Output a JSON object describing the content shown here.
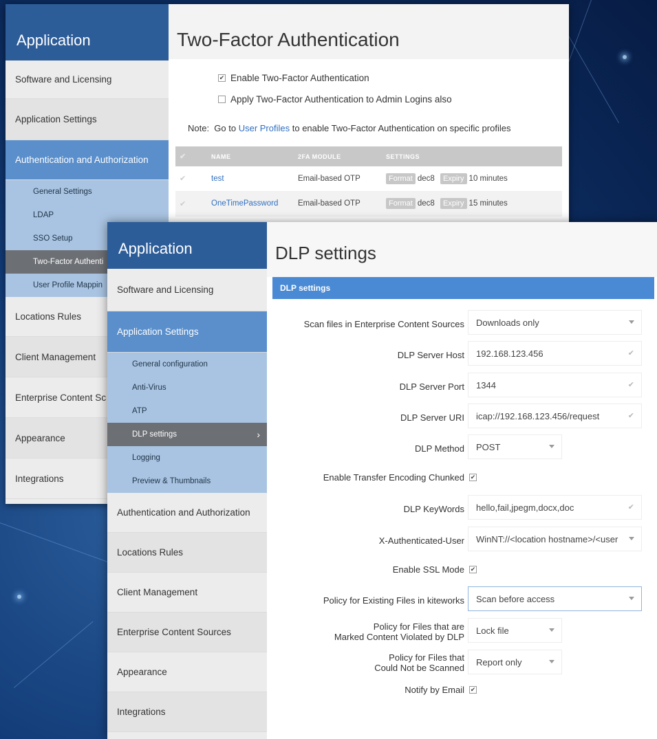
{
  "back_window": {
    "sidebar": {
      "app_title": "Application",
      "items": [
        {
          "label": "Software and Licensing"
        },
        {
          "label": "Application Settings"
        },
        {
          "label": "Authentication and Authorization"
        },
        {
          "label": "Locations Rules"
        },
        {
          "label": "Client Management"
        },
        {
          "label": "Enterprise Content Sc"
        },
        {
          "label": "Appearance"
        },
        {
          "label": "Integrations"
        }
      ],
      "sub_items": [
        {
          "label": "General Settings"
        },
        {
          "label": "LDAP"
        },
        {
          "label": "SSO Setup"
        },
        {
          "label": "Two-Factor Authenti"
        },
        {
          "label": "User Profile Mappin"
        }
      ]
    },
    "main": {
      "title": "Two-Factor Authentication",
      "enable_2fa_label": "Enable Two-Factor Authentication",
      "admin_2fa_label": "Apply Two-Factor Authentication to Admin Logins also",
      "note_prefix": "Note:  Go to ",
      "note_link": "User Profiles",
      "note_suffix": " to enable Two-Factor Authentication on specific profiles",
      "table": {
        "headers": [
          "NAME",
          "2FA MODULE",
          "SETTINGS"
        ],
        "rows": [
          {
            "name": "test",
            "module": "Email-based OTP",
            "format_tag": "Format",
            "format": "dec8",
            "expiry_tag": "Expiry",
            "expiry": "10 minutes"
          },
          {
            "name": "OneTimePassword",
            "module": "Email-based OTP",
            "format_tag": "Format",
            "format": "dec8",
            "expiry_tag": "Expiry",
            "expiry": "15 minutes"
          }
        ]
      }
    }
  },
  "front_window": {
    "sidebar": {
      "app_title": "Application",
      "items": [
        {
          "label": "Software and Licensing"
        },
        {
          "label": "Application Settings"
        },
        {
          "label": "Authentication and Authorization"
        },
        {
          "label": "Locations Rules"
        },
        {
          "label": "Client Management"
        },
        {
          "label": "Enterprise Content Sources"
        },
        {
          "label": "Appearance"
        },
        {
          "label": "Integrations"
        }
      ],
      "sub_items": [
        {
          "label": "General configuration"
        },
        {
          "label": "Anti-Virus"
        },
        {
          "label": "ATP"
        },
        {
          "label": "DLP settings"
        },
        {
          "label": "Logging"
        },
        {
          "label": "Preview & Thumbnails"
        }
      ]
    },
    "main": {
      "title": "DLP settings",
      "section_title": "DLP settings",
      "fields": {
        "scan_files": {
          "label": "Scan files in Enterprise Content Sources",
          "value": "Downloads only"
        },
        "server_host": {
          "label": "DLP Server Host",
          "value": "192.168.123.456"
        },
        "server_port": {
          "label": "DLP Server Port",
          "value": "1344"
        },
        "server_uri": {
          "label": "DLP Server URI",
          "value": "icap://192.168.123.456/request"
        },
        "method": {
          "label": "DLP Method",
          "value": "POST"
        },
        "transfer_chunked": {
          "label": "Enable Transfer Encoding Chunked"
        },
        "keywords": {
          "label": "DLP KeyWords",
          "value": "hello,fail,jpegm,docx,doc"
        },
        "auth_user": {
          "label": "X-Authenticated-User",
          "value": "WinNT://<location hostname>/<user"
        },
        "ssl_mode": {
          "label": "Enable SSL Mode"
        },
        "existing_files": {
          "label": "Policy for Existing Files in kiteworks",
          "value": "Scan before access"
        },
        "violated_files": {
          "label_line1": "Policy for Files that are",
          "label_line2": "Marked Content Violated by DLP",
          "value": "Lock file"
        },
        "not_scanned": {
          "label_line1": "Policy for Files that",
          "label_line2": "Could Not be Scanned",
          "value": "Report only"
        },
        "notify_email": {
          "label": "Notify by Email"
        }
      }
    }
  }
}
